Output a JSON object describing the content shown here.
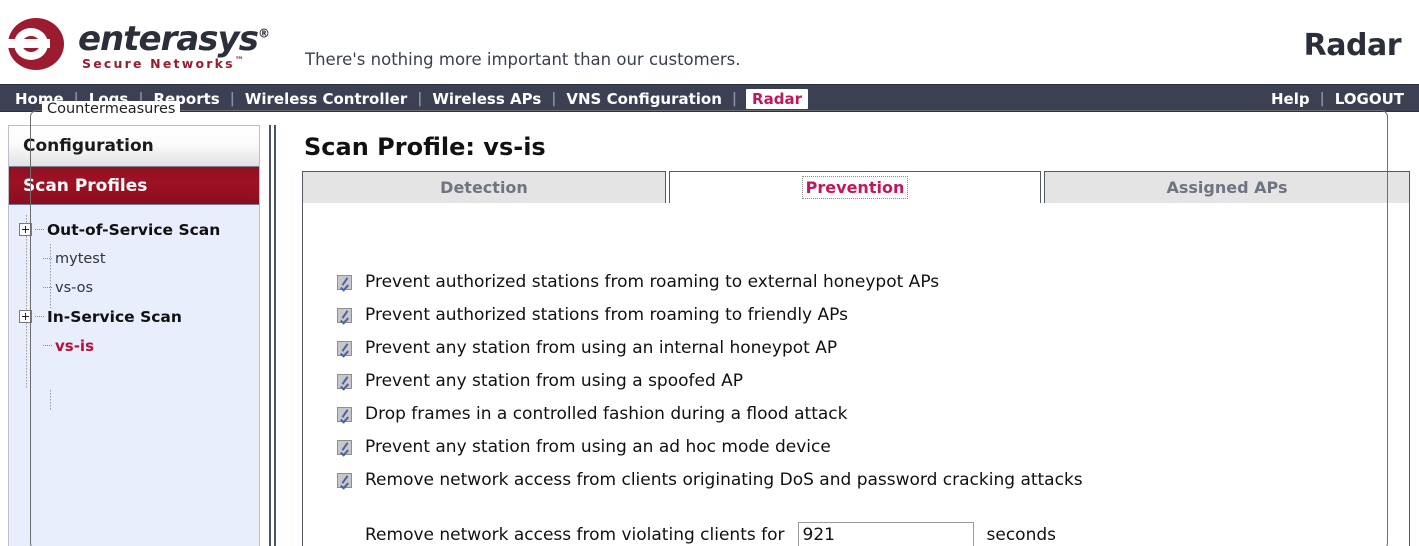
{
  "branding": {
    "wordmark": "enterasys",
    "registered": "®",
    "sub_wordmark": "Secure Networks",
    "trademark": "™",
    "tagline": "There's nothing more important than our customers.",
    "product_title": "Radar",
    "logo_icon": "enterasys-circle-e-logo"
  },
  "nav": {
    "items": [
      {
        "label": "Home",
        "active": false
      },
      {
        "label": "Logs",
        "active": false
      },
      {
        "label": "Reports",
        "active": false
      },
      {
        "label": "Wireless Controller",
        "active": false
      },
      {
        "label": "Wireless APs",
        "active": false
      },
      {
        "label": "VNS Configuration",
        "active": false
      },
      {
        "label": "Radar",
        "active": true
      }
    ],
    "separator": "|",
    "right_items": [
      {
        "label": "Help"
      },
      {
        "label": "LOGOUT"
      }
    ]
  },
  "sidebar": {
    "title": "Configuration",
    "section": "Scan Profiles",
    "tree": [
      {
        "label": "Out-of-Service Scan",
        "type": "group",
        "expander": "plus-expander-icon",
        "children": [
          {
            "label": "mytest",
            "selected": false
          },
          {
            "label": "vs-os",
            "selected": false
          }
        ]
      },
      {
        "label": "In-Service Scan",
        "type": "group",
        "expander": "plus-expander-icon",
        "children": [
          {
            "label": "vs-is",
            "selected": true
          }
        ]
      }
    ]
  },
  "main": {
    "page_title": "Scan Profile: vs-is",
    "tabs": [
      {
        "label": "Detection",
        "active": false
      },
      {
        "label": "Prevention",
        "active": true
      },
      {
        "label": "Assigned APs",
        "active": false
      }
    ],
    "fieldset": {
      "legend": "Countermeasures",
      "checkboxes": [
        {
          "label": "Prevent authorized stations from roaming to external honeypot APs",
          "checked": true
        },
        {
          "label": "Prevent authorized stations from roaming to friendly APs",
          "checked": true
        },
        {
          "label": "Prevent any station from using an internal honeypot AP",
          "checked": true
        },
        {
          "label": "Prevent any station from using a spoofed AP",
          "checked": true
        },
        {
          "label": "Drop frames in a controlled fashion during a flood attack",
          "checked": true
        },
        {
          "label": "Prevent any station from using an ad hoc mode device",
          "checked": true
        },
        {
          "label": "Remove network access from clients originating DoS and password cracking attacks",
          "checked": true
        }
      ],
      "duration_row": {
        "prefix": "Remove network access from violating clients for",
        "value": "921",
        "suffix": "seconds"
      }
    }
  },
  "colors": {
    "brand_red": "#9b1b30",
    "nav_bg": "#3b4152",
    "accent_crimson": "#c2185b",
    "selected_tree": "#b4123a",
    "sidebar_bg": "#e8eefb"
  }
}
